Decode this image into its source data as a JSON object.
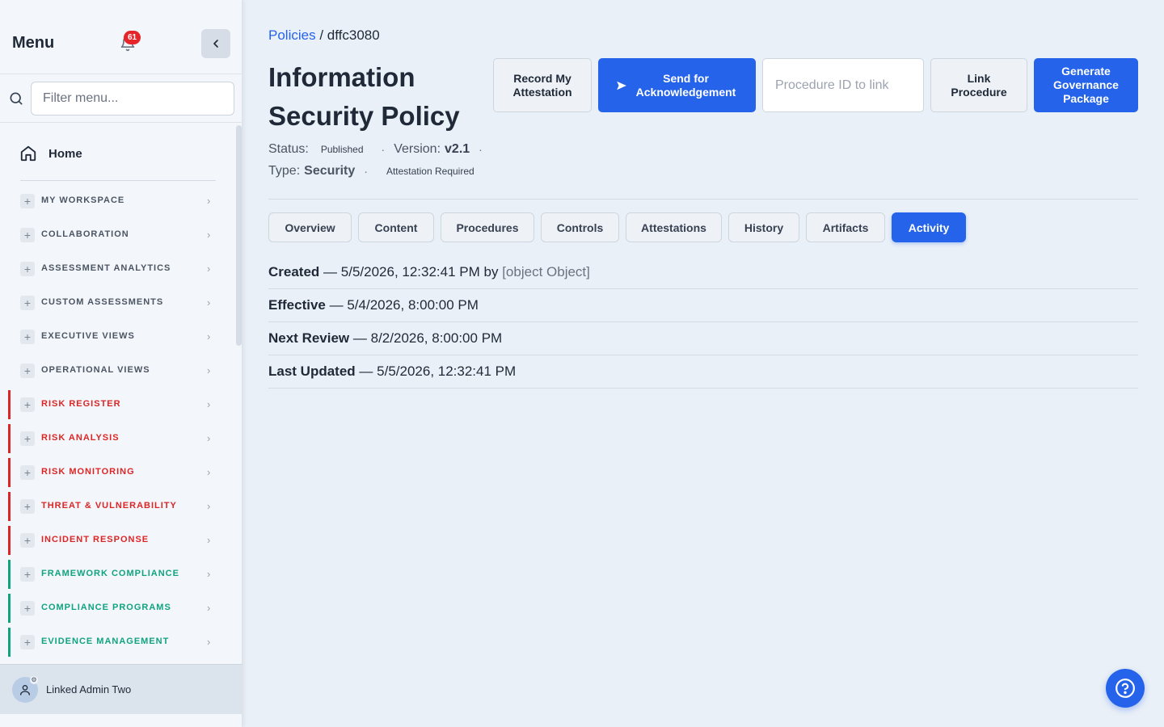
{
  "sidebar": {
    "title": "Menu",
    "notification_count": "61",
    "search": {
      "placeholder": "Filter menu..."
    },
    "home_label": "Home",
    "items": [
      {
        "label": "MY WORKSPACE",
        "color": "#4b5563",
        "bar": ""
      },
      {
        "label": "COLLABORATION",
        "color": "#4b5563",
        "bar": ""
      },
      {
        "label": "ASSESSMENT ANALYTICS",
        "color": "#4b5563",
        "bar": ""
      },
      {
        "label": "CUSTOM ASSESSMENTS",
        "color": "#4b5563",
        "bar": ""
      },
      {
        "label": "EXECUTIVE VIEWS",
        "color": "#4b5563",
        "bar": ""
      },
      {
        "label": "OPERATIONAL VIEWS",
        "color": "#4b5563",
        "bar": ""
      },
      {
        "label": "RISK REGISTER",
        "color": "#dc2626",
        "bar": "#dc2626"
      },
      {
        "label": "RISK ANALYSIS",
        "color": "#dc2626",
        "bar": "#dc2626"
      },
      {
        "label": "RISK MONITORING",
        "color": "#dc2626",
        "bar": "#dc2626"
      },
      {
        "label": "THREAT & VULNERABILITY",
        "color": "#dc2626",
        "bar": "#dc2626"
      },
      {
        "label": "INCIDENT RESPONSE",
        "color": "#dc2626",
        "bar": "#dc2626"
      },
      {
        "label": "FRAMEWORK COMPLIANCE",
        "color": "#10a37f",
        "bar": "#10a37f"
      },
      {
        "label": "COMPLIANCE PROGRAMS",
        "color": "#10a37f",
        "bar": "#10a37f"
      },
      {
        "label": "EVIDENCE MANAGEMENT",
        "color": "#10a37f",
        "bar": "#10a37f"
      }
    ],
    "user_name": "Linked Admin Two"
  },
  "breadcrumb": {
    "parent": "Policies",
    "separator": "/",
    "current": "dffc3080"
  },
  "policy": {
    "title": "Information Security Policy",
    "status_label": "Status:",
    "status_value": "Published",
    "version_label": "Version:",
    "version_value": "v2.1",
    "type_label": "Type:",
    "type_value": "Security",
    "attestation_label": "Attestation Required"
  },
  "actions": {
    "record": "Record My Attestation",
    "send": "Send for Acknowledgement",
    "procedure_placeholder": "Procedure ID to link",
    "link": "Link Procedure",
    "generate": "Generate Governance Package"
  },
  "tabs": [
    {
      "label": "Overview",
      "active": false
    },
    {
      "label": "Content",
      "active": false
    },
    {
      "label": "Procedures",
      "active": false
    },
    {
      "label": "Controls",
      "active": false
    },
    {
      "label": "Attestations",
      "active": false
    },
    {
      "label": "History",
      "active": false
    },
    {
      "label": "Artifacts",
      "active": false
    },
    {
      "label": "Activity",
      "active": true
    }
  ],
  "activity": [
    {
      "label": "Created",
      "value": "— 5/5/2026, 12:32:41 PM by",
      "by": "[object Object]"
    },
    {
      "label": "Effective",
      "value": "— 5/4/2026, 8:00:00 PM",
      "by": ""
    },
    {
      "label": "Next Review",
      "value": "— 8/2/2026, 8:00:00 PM",
      "by": ""
    },
    {
      "label": "Last Updated",
      "value": "— 5/5/2026, 12:32:41 PM",
      "by": ""
    }
  ],
  "colors": {
    "accent": "#2563eb",
    "risk": "#dc2626",
    "compliance": "#10a37f",
    "badge": "#e5252a"
  }
}
